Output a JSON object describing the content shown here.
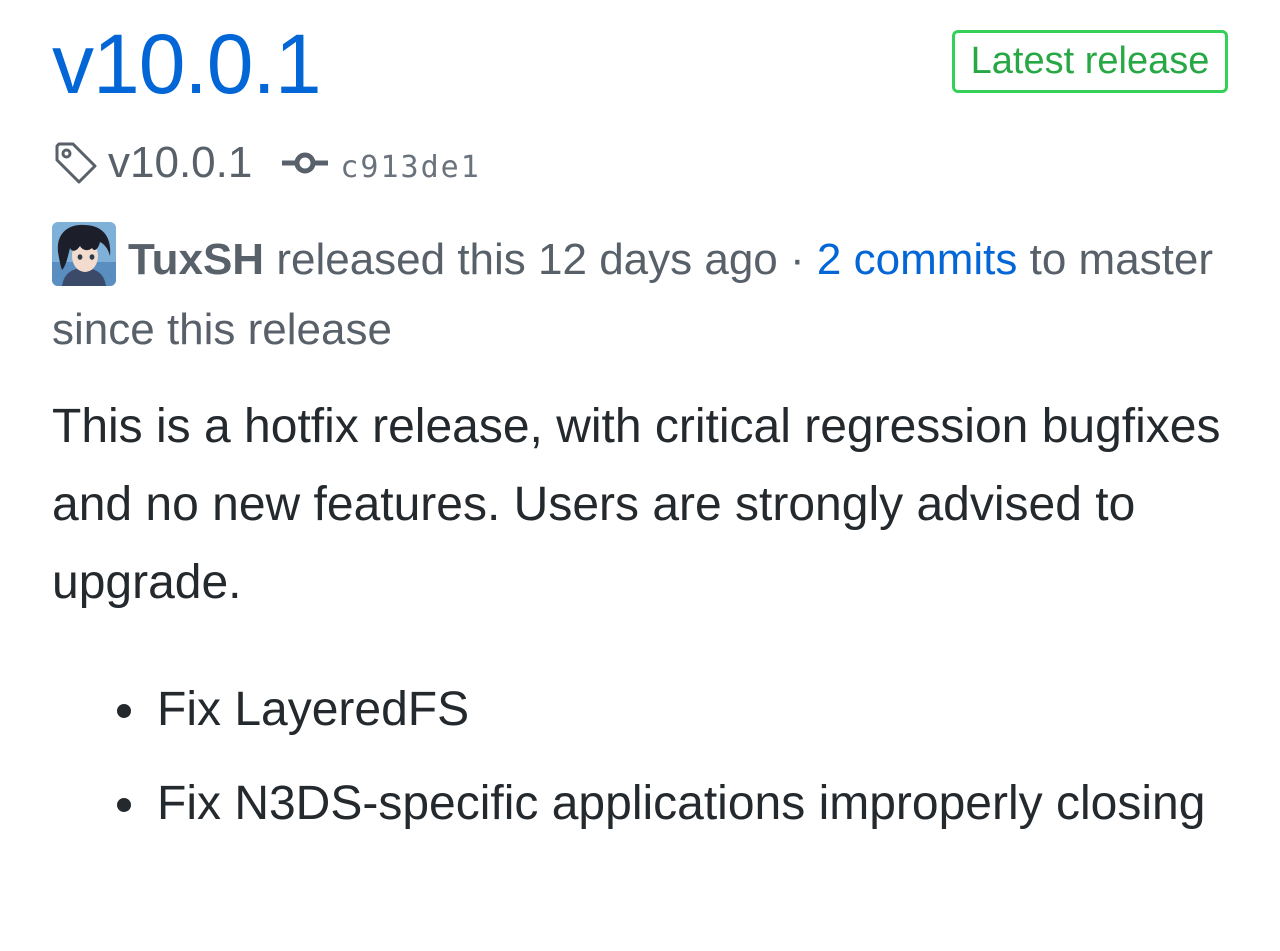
{
  "release": {
    "title": "v10.0.1",
    "badge": "Latest release",
    "tag": "v10.0.1",
    "commit": "c913de1",
    "author": "TuxSH",
    "released_text": "released this 12 days ago",
    "separator": "·",
    "commits_link": "2 commits",
    "commits_suffix": "to master since this release",
    "body": "This is a hotfix release, with critical regression bugfixes and no new features. Users are strongly advised to upgrade.",
    "changes": [
      "Fix LayeredFS",
      "Fix N3DS-specific applications improperly closing"
    ]
  },
  "icons": {
    "tag": "tag-icon",
    "commit": "git-commit-icon",
    "avatar": "user-avatar"
  },
  "colors": {
    "link": "#0366d6",
    "badge": "#28a745",
    "muted": "#586069",
    "text": "#24292e"
  }
}
